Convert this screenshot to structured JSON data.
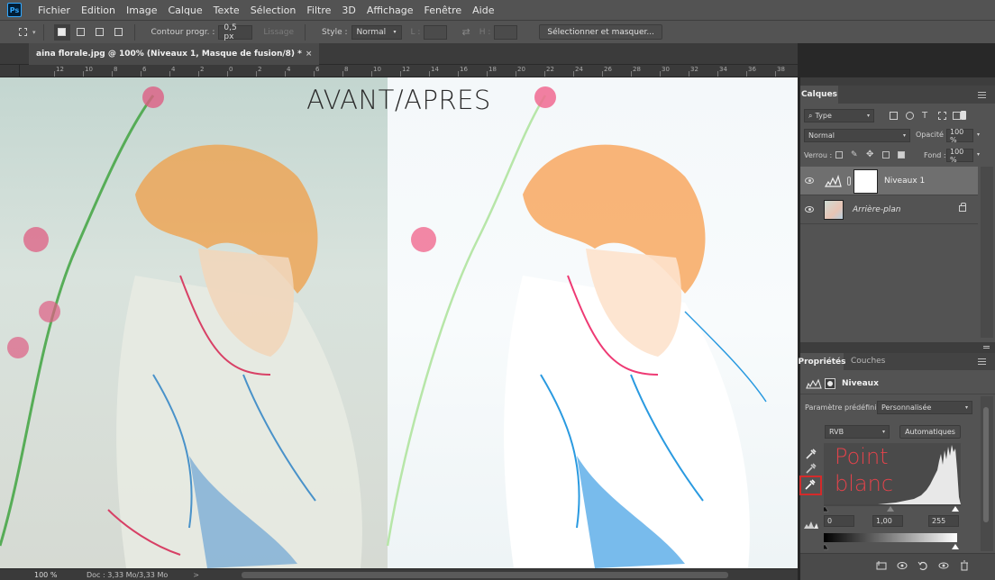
{
  "app": {
    "logo": "Ps"
  },
  "menu": [
    "Fichier",
    "Edition",
    "Image",
    "Calque",
    "Texte",
    "Sélection",
    "Filtre",
    "3D",
    "Affichage",
    "Fenêtre",
    "Aide"
  ],
  "options": {
    "feather_label": "Contour progr. :",
    "feather_value": "0,5 px",
    "antialias_label": "Lissage",
    "style_label": "Style :",
    "style_value": "Normal",
    "width_label": "L :",
    "height_label": "H :",
    "select_mask_button": "Sélectionner et masquer..."
  },
  "document": {
    "tab_title": "aina florale.jpg @ 100% (Niveaux 1, Masque de fusion/8) *",
    "close_glyph": "×",
    "canvas_title": "AVANT/APRES"
  },
  "ruler": {
    "labels": [
      "12",
      "10",
      "8",
      "6",
      "4",
      "2",
      "0",
      "2",
      "4",
      "6",
      "8",
      "10",
      "12",
      "14",
      "16",
      "18",
      "20",
      "22",
      "24",
      "26",
      "28",
      "30",
      "32",
      "34",
      "36",
      "38",
      "40"
    ]
  },
  "status": {
    "zoom": "100 %",
    "doc_info": "Doc : 3,33 Mo/3,33 Mo",
    "arrow": ">"
  },
  "layers_panel": {
    "tab": "Calques",
    "filter_value": "Type",
    "blend_mode": "Normal",
    "opacity_label": "Opacité :",
    "opacity_value": "100 %",
    "lock_label": "Verrou :",
    "fill_label": "Fond :",
    "fill_value": "100 %",
    "layers": [
      {
        "name": "Niveaux 1",
        "selected": true
      },
      {
        "name": "Arrière-plan",
        "selected": false
      }
    ]
  },
  "properties_panel": {
    "tab_properties": "Propriétés",
    "tab_channels": "Couches",
    "title": "Niveaux",
    "preset_label": "Paramètre prédéfini :",
    "preset_value": "Personnalisée",
    "channel_value": "RVB",
    "auto_button": "Automatiques",
    "input_black": "0",
    "input_gamma": "1,00",
    "input_white": "255",
    "annotation_line1": "Point",
    "annotation_line2": "blanc",
    "annotation_color": "#e1434b",
    "highlight_color": "#d42a2a"
  }
}
